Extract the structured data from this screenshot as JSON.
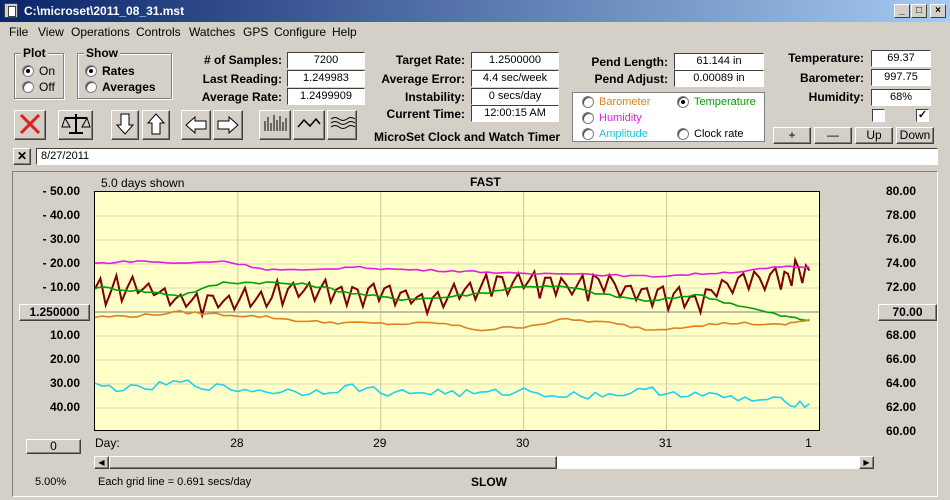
{
  "window": {
    "title": "C:\\microset\\2011_08_31.mst"
  },
  "menu": [
    "File",
    "View",
    "Operations",
    "Controls",
    "Watches",
    "GPS",
    "Configure",
    "Help"
  ],
  "plot": {
    "label": "Plot",
    "on": "On",
    "off": "Off",
    "selected": "On"
  },
  "show": {
    "label": "Show",
    "rates": "Rates",
    "averages": "Averages",
    "selected": "Rates"
  },
  "stats": {
    "samples_label": "# of Samples:",
    "samples": "7200",
    "last_label": "Last Reading:",
    "last": "1.249983",
    "avg_label": "Average Rate:",
    "avg": "1.2499909",
    "target_label": "Target Rate:",
    "target": "1.2500000",
    "avgerr_label": "Average Error:",
    "avgerr": "4.4 sec/week",
    "instab_label": "Instability:",
    "instab": "0 secs/day",
    "time_label": "Current Time:",
    "time": "12:00:15 AM",
    "pendlen_label": "Pend Length:",
    "pendlen": "61.144 in",
    "pendadj_label": "Pend Adjust:",
    "pendadj": "0.00089 in",
    "temp_label": "Temperature:",
    "temp": "69.37",
    "baro_label": "Barometer:",
    "baro": "997.75",
    "hum_label": "Humidity:",
    "hum": "68%"
  },
  "app_title": "MicroSet Clock and Watch Timer",
  "overlay": {
    "barometer": "Barometer",
    "temperature": "Temperature",
    "humidity": "Humidity",
    "amplitude": "Amplitude",
    "clockrate": "Clock rate",
    "selected": "Temperature"
  },
  "right_buttons": {
    "plus": "+",
    "minus": "—",
    "up": "Up",
    "down": "Down"
  },
  "date_field": "8/27/2011",
  "chart": {
    "days_shown": "5.0 days shown",
    "top_label": "FAST",
    "bottom_label": "SLOW",
    "center_value": "1.250000",
    "right_center": "70.00",
    "zero_button": "0",
    "percent": "5.00%",
    "grid_note": "Each grid line = 0.691 secs/day",
    "day_label": "Day:"
  },
  "colors": {
    "rate": "#800000",
    "temperature": "#00a000",
    "barometer": "#e08020",
    "humidity": "#e020e0",
    "amplitude": "#20d0f0",
    "plot_bg": "#ffffc8"
  },
  "chart_data": {
    "type": "line",
    "y_left_ticks": [
      "50.00",
      "40.00",
      "30.00",
      "20.00",
      "10.00",
      "1.250000",
      "10.00",
      "20.00",
      "30.00",
      "40.00"
    ],
    "y_right_ticks": [
      "80.00",
      "78.00",
      "76.00",
      "74.00",
      "72.00",
      "70.00",
      "68.00",
      "66.00",
      "64.00",
      "62.00",
      "60.00"
    ],
    "x_ticks": [
      "28",
      "29",
      "30",
      "31",
      "1"
    ],
    "ylim_right": [
      60,
      80
    ],
    "series": [
      {
        "name": "Rate",
        "color": "#800000",
        "x": [
          27.0,
          27.3,
          27.6,
          27.9,
          28.2,
          28.5,
          28.8,
          29.1,
          29.4,
          29.7,
          30.0,
          30.3,
          30.6,
          30.9,
          31.2,
          31.5,
          31.8,
          32.0
        ],
        "y": [
          71.5,
          72.2,
          71.0,
          70.8,
          71.3,
          71.8,
          71.6,
          71.2,
          70.9,
          72.1,
          72.5,
          72.0,
          72.3,
          71.6,
          71.0,
          72.4,
          73.1,
          73.4
        ]
      },
      {
        "name": "Temperature",
        "color": "#00a000",
        "x": [
          27.0,
          27.3,
          27.6,
          27.9,
          28.2,
          28.5,
          28.8,
          29.1,
          29.4,
          29.7,
          30.0,
          30.3,
          30.6,
          30.9,
          31.2,
          31.5,
          31.8,
          32.0
        ],
        "y": [
          72.0,
          71.7,
          71.3,
          72.4,
          72.4,
          72.2,
          71.5,
          71.0,
          71.1,
          71.5,
          72.1,
          72.0,
          71.3,
          70.8,
          71.4,
          70.5,
          69.6,
          69.2
        ]
      },
      {
        "name": "Barometer",
        "color": "#e08020",
        "x": [
          27.0,
          27.3,
          27.6,
          27.9,
          28.2,
          28.5,
          28.8,
          29.1,
          29.4,
          29.7,
          30.0,
          30.3,
          30.6,
          30.9,
          31.2,
          31.5,
          31.8,
          32.0
        ],
        "y": [
          69.5,
          69.6,
          69.9,
          69.7,
          69.5,
          69.1,
          69.0,
          68.9,
          69.0,
          68.4,
          68.7,
          69.3,
          69.0,
          68.4,
          68.8,
          69.0,
          68.8,
          69.3
        ]
      },
      {
        "name": "Humidity",
        "color": "#e020e0",
        "x": [
          27.0,
          27.3,
          27.6,
          27.9,
          28.2,
          28.5,
          28.8,
          29.1,
          29.4,
          29.7,
          30.0,
          30.3,
          30.6,
          30.9,
          31.2,
          31.5,
          31.8,
          32.0
        ],
        "y": [
          74.0,
          74.2,
          74.0,
          74.2,
          73.5,
          73.4,
          73.7,
          73.5,
          73.4,
          73.3,
          73.1,
          73.2,
          73.0,
          72.9,
          73.1,
          73.3,
          73.7,
          73.7
        ]
      },
      {
        "name": "Amplitude",
        "color": "#20d0f0",
        "x": [
          27.0,
          27.3,
          27.6,
          27.9,
          28.2,
          28.5,
          28.8,
          29.1,
          29.4,
          29.7,
          30.0,
          30.3,
          30.6,
          30.9,
          31.2,
          31.5,
          31.8,
          32.0
        ],
        "y": [
          63.7,
          63.4,
          64.0,
          63.5,
          63.3,
          63.2,
          63.6,
          63.1,
          63.2,
          63.0,
          63.3,
          62.9,
          63.0,
          63.3,
          63.0,
          62.6,
          62.4,
          62.2
        ]
      }
    ]
  }
}
